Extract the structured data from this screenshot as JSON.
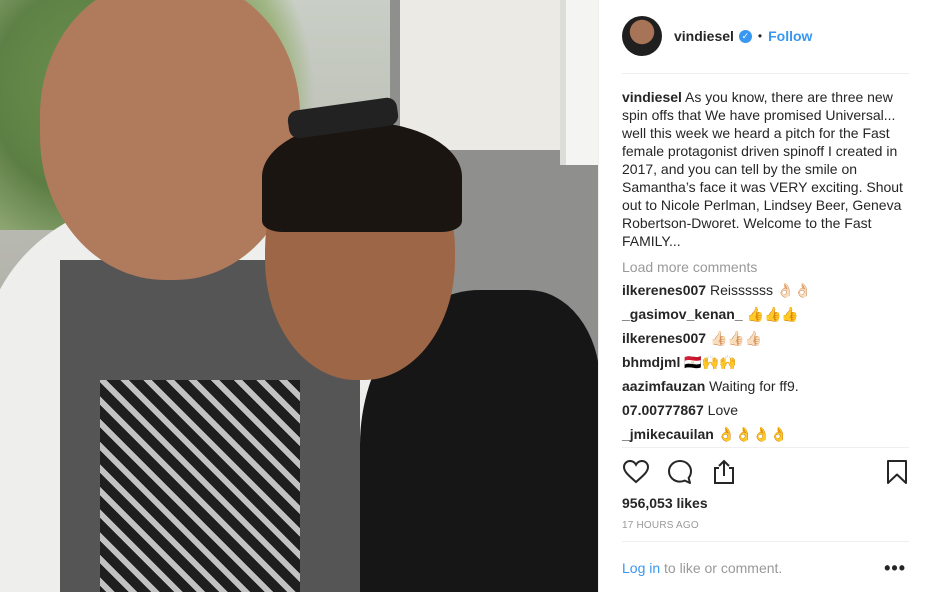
{
  "header": {
    "username": "vindiesel",
    "follow_label": "Follow"
  },
  "caption": {
    "username": "vindiesel",
    "text": "As you know, there are three new spin offs that We have promised Universal... well this week we heard a pitch for the Fast female protagonist driven spinoff I created in 2017, and you can tell by the smile on Samantha’s face it was VERY exciting. Shout out to Nicole Perlman, Lindsey Beer, Geneva Robertson-Dworet. Welcome to the Fast FAMILY..."
  },
  "load_more_label": "Load more comments",
  "comments": [
    {
      "user": "ilkerenes007",
      "text": "Reissssss 👌🏻👌🏻"
    },
    {
      "user": "_gasimov_kenan_",
      "text": "👍👍👍"
    },
    {
      "user": "ilkerenes007",
      "text": "👍🏻👍🏻👍🏻"
    },
    {
      "user": "bhmdjml",
      "text": "🇪🇬🙌🙌"
    },
    {
      "user": "aazimfauzan",
      "text": "Waiting for ff9."
    },
    {
      "user": "07.00777867",
      "text": "Love"
    },
    {
      "user": "_jmikecauilan",
      "text": "👌👌👌👌"
    }
  ],
  "likes": "956,053 likes",
  "time": "17 HOURS AGO",
  "login": {
    "link": "Log in",
    "suffix": " to like or comment."
  },
  "more_label": "•••",
  "colors": {
    "accent": "#3897f0",
    "muted": "#999999",
    "border": "#efefef",
    "text": "#262626"
  },
  "icons": [
    "heart-icon",
    "comment-icon",
    "share-icon",
    "bookmark-icon",
    "verified-icon",
    "more-icon"
  ]
}
